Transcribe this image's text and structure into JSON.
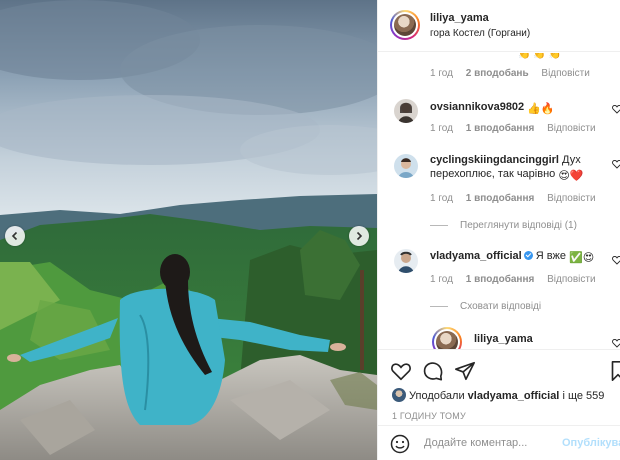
{
  "header": {
    "username": "liliya_yama",
    "location": "гора Костел (Горгани)"
  },
  "comments": [
    {
      "meta_time": "1 год",
      "meta_likes": "2 вподобань",
      "meta_reply": "Відповісти"
    },
    {
      "username": "ovsiannikova9802",
      "text": "👍🔥",
      "meta_time": "1 год",
      "meta_likes": "1 вподобання",
      "meta_reply": "Відповісти"
    },
    {
      "username": "cyclingskiingdancinggirl",
      "text": "Дух перехоплює, так чарівно",
      "text_emoji": "😍❤️",
      "meta_time": "1 год",
      "meta_likes": "1 вподобання",
      "meta_reply": "Відповісти",
      "replies_link": "Переглянути відповіді (1)"
    },
    {
      "username": "vladyama_official",
      "text": "Я вже",
      "text_emoji": "✅😍",
      "meta_time": "1 год",
      "meta_likes": "1 вподобання",
      "meta_reply": "Відповісти",
      "replies_link": "Сховати відповіді"
    },
    {
      "username": "liliya_yama"
    }
  ],
  "actions": {
    "liked_by_prefix": "Уподобали",
    "liked_by_user": "vladyama_official",
    "liked_by_suffix": "і ще 559",
    "timestamp": "1 ГОДИНУ ТОМУ"
  },
  "add_comment": {
    "placeholder": "Додайте коментар...",
    "post_label": "Опублікувати"
  },
  "icons": [
    "chevron-left-icon",
    "chevron-right-icon",
    "heart-icon",
    "comment-icon",
    "share-icon",
    "bookmark-icon",
    "smile-icon",
    "verified-icon"
  ],
  "colors": {
    "link_blue": "#3897f0",
    "post_disabled": "#b2dffc",
    "meta_gray": "#8e8e8e",
    "text": "#262626",
    "jacket_teal": "#3fb3c8"
  }
}
